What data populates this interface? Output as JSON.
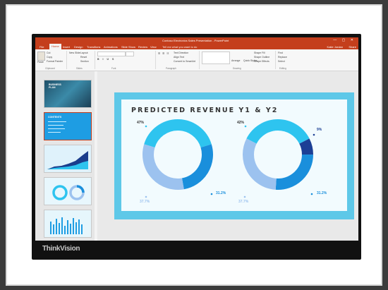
{
  "window": {
    "title": "Contoso Electronics Sales Presentation - PowerPoint",
    "controls": "—  ▢  ✕"
  },
  "brand": "ThinkVision",
  "tabs": [
    "File",
    "Home",
    "Insert",
    "Design",
    "Transitions",
    "Animations",
    "Slide Show",
    "Review",
    "View"
  ],
  "active_tab": "Home",
  "tell_me": "Tell me what you want to do",
  "user": "Katie Jordan",
  "share_label": "Share",
  "ribbon": {
    "clipboard": {
      "paste": "Paste",
      "cut": "Cut",
      "copy": "Copy",
      "format_painter": "Format Painter",
      "label": "Clipboard"
    },
    "slides": {
      "new_slide": "New Slide",
      "layout": "Layout",
      "reset": "Reset",
      "section": "Section",
      "label": "Slides"
    },
    "font": {
      "label": "Font"
    },
    "paragraph": {
      "text_direction": "Text Direction",
      "align_text": "Align Text",
      "convert": "Convert to SmartArt",
      "label": "Paragraph"
    },
    "drawing": {
      "arrange": "Arrange",
      "quick_styles": "Quick Styles",
      "shape_fill": "Shape Fill",
      "shape_outline": "Shape Outline",
      "shape_effects": "Shape Effects",
      "label": "Drawing"
    },
    "editing": {
      "find": "Find",
      "replace": "Replace",
      "select": "Select",
      "label": "Editing"
    }
  },
  "thumbnails": [
    {
      "num": "1",
      "title": "BUSINESS PLAN"
    },
    {
      "num": "2",
      "title": "CONTENTS"
    },
    {
      "num": "3",
      "title": ""
    },
    {
      "num": "4",
      "title": ""
    },
    {
      "num": "5",
      "title": ""
    }
  ],
  "slide": {
    "title": "PREDICTED REVENUE Y1 & Y2"
  },
  "chart_data": [
    {
      "type": "pie",
      "categories": [
        "47%",
        "31.2%",
        "37.7%"
      ],
      "values": [
        47,
        31.2,
        37.7
      ],
      "labels": [
        "47%",
        "31.2%",
        "37.7%"
      ]
    },
    {
      "type": "pie",
      "categories": [
        "42%",
        "9%",
        "31.2%",
        "37.7%"
      ],
      "values": [
        42,
        9,
        31.2,
        37.7
      ],
      "labels": [
        "42%",
        "9%",
        "31.2%",
        "37.7%"
      ]
    }
  ],
  "colors": {
    "ppt_red": "#c43e1c",
    "slide_bg": "#5ec8e8",
    "panel_bg": "#f2fbfe",
    "cyan": "#2ec4ef",
    "blue": "#1a8fdc",
    "light_blue": "#9cc2ef",
    "navy": "#1c3f95"
  }
}
